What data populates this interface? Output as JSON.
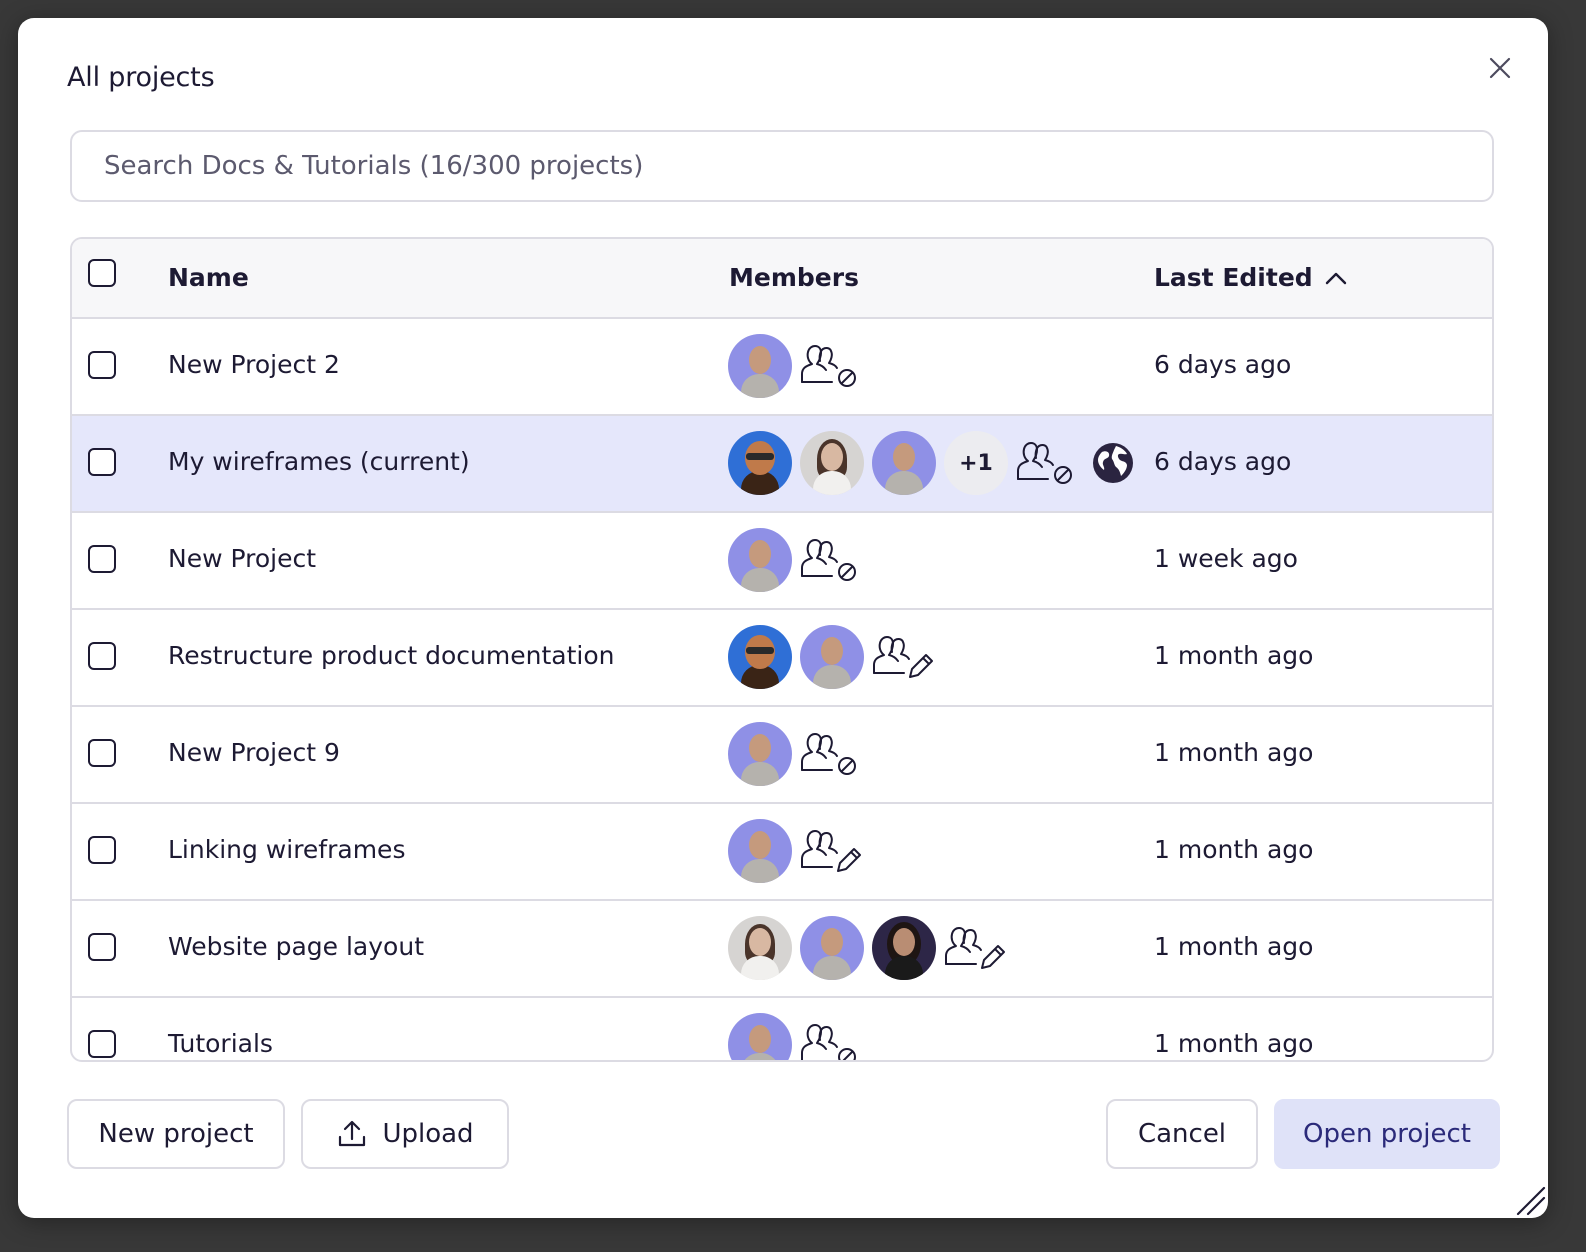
{
  "dialog": {
    "title": "All projects",
    "search_placeholder": "Search Docs & Tutorials (16/300 projects)"
  },
  "table": {
    "columns": {
      "name": "Name",
      "members": "Members",
      "last_edited": "Last Edited",
      "sort": "ascending"
    },
    "rows": [
      {
        "name": "New Project 2",
        "members": [
          "lavender"
        ],
        "extra": "",
        "permission": "no-access",
        "public": false,
        "last_edited": "6 days ago",
        "selected": false
      },
      {
        "name": "My wireframes (current)",
        "members": [
          "beard",
          "grey",
          "lavender"
        ],
        "extra": "+1",
        "permission": "no-access",
        "public": true,
        "last_edited": "6 days ago",
        "selected": true
      },
      {
        "name": "New Project",
        "members": [
          "lavender"
        ],
        "extra": "",
        "permission": "no-access",
        "public": false,
        "last_edited": "1 week ago",
        "selected": false
      },
      {
        "name": "Restructure product documentation",
        "members": [
          "beard",
          "lavender"
        ],
        "extra": "",
        "permission": "can-edit",
        "public": false,
        "last_edited": "1 month ago",
        "selected": false
      },
      {
        "name": "New Project 9",
        "members": [
          "lavender"
        ],
        "extra": "",
        "permission": "no-access",
        "public": false,
        "last_edited": "1 month ago",
        "selected": false
      },
      {
        "name": "Linking wireframes",
        "members": [
          "lavender"
        ],
        "extra": "",
        "permission": "can-edit",
        "public": false,
        "last_edited": "1 month ago",
        "selected": false
      },
      {
        "name": "Website page layout",
        "members": [
          "grey",
          "lavender",
          "dark"
        ],
        "extra": "",
        "permission": "can-edit",
        "public": false,
        "last_edited": "1 month ago",
        "selected": false
      },
      {
        "name": "Tutorials",
        "members": [
          "lavender"
        ],
        "extra": "",
        "permission": "no-access",
        "public": false,
        "last_edited": "1 month ago",
        "selected": false
      }
    ]
  },
  "footer": {
    "new_project": "New project",
    "upload": "Upload",
    "cancel": "Cancel",
    "open_project": "Open project"
  },
  "colors": {
    "accent": "#dfe2f8",
    "selected_row": "#e5e7fb",
    "border": "#dcdbe3"
  }
}
